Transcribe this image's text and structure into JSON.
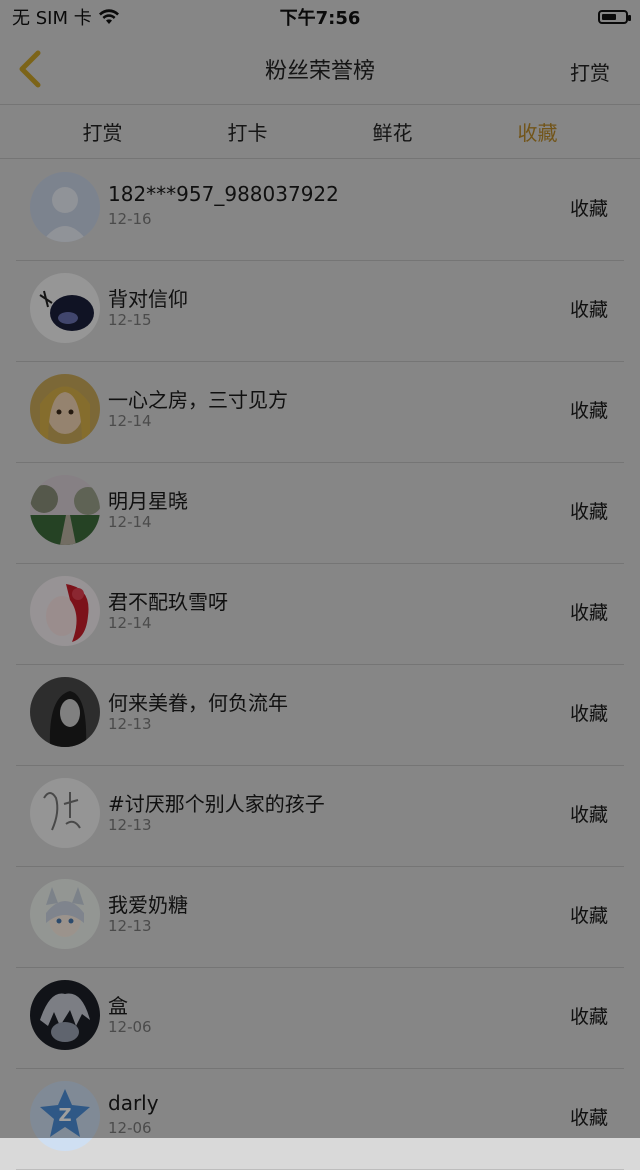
{
  "status_bar": {
    "carrier": "无 SIM 卡",
    "time": "下午7:56"
  },
  "navbar": {
    "title": "粉丝荣誉榜",
    "right_label": "打赏"
  },
  "tabs": [
    {
      "label": "打赏",
      "active": false
    },
    {
      "label": "打卡",
      "active": false
    },
    {
      "label": "鲜花",
      "active": false
    },
    {
      "label": "收藏",
      "active": true
    }
  ],
  "fans": [
    {
      "name": "182***957_988037922",
      "date": "12-16",
      "action": "收藏",
      "avatar": "default-avatar"
    },
    {
      "name": "背对信仰",
      "date": "12-15",
      "action": "收藏",
      "avatar": "ink-painting"
    },
    {
      "name": "一心之房，三寸见方",
      "date": "12-14",
      "action": "收藏",
      "avatar": "girl-photo"
    },
    {
      "name": "明月星晓",
      "date": "12-14",
      "action": "收藏",
      "avatar": "forest-path"
    },
    {
      "name": "君不配玖雪呀",
      "date": "12-14",
      "action": "收藏",
      "avatar": "anime-red-hair"
    },
    {
      "name": "何来美眷，何负流年",
      "date": "12-13",
      "action": "收藏",
      "avatar": "gray-portrait"
    },
    {
      "name": "#讨厌那个别人家的孩子",
      "date": "12-13",
      "action": "收藏",
      "avatar": "sketch-calligraphy"
    },
    {
      "name": "我爱奶糖",
      "date": "12-13",
      "action": "收藏",
      "avatar": "anime-fox-girl"
    },
    {
      "name": "盒",
      "date": "12-06",
      "action": "收藏",
      "avatar": "dark-anime"
    },
    {
      "name": "darly",
      "date": "12-06",
      "action": "收藏",
      "avatar": "blue-z-logo"
    }
  ]
}
